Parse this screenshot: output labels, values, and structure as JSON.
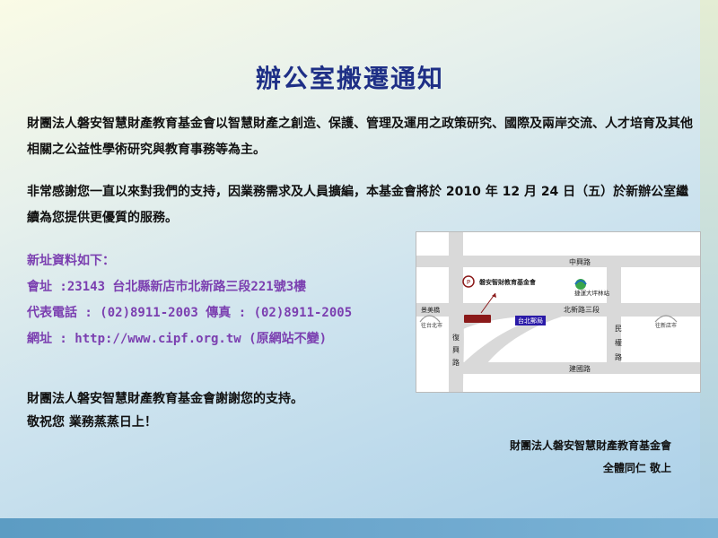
{
  "notice": {
    "title": "辦公室搬遷通知",
    "intro": "財團法人磐安智慧財產教育基金會以智慧財產之創造、保護、管理及運用之政策研究、國際及兩岸交流、人才培育及其他相關之公益性學術研究與教育事務等為主。",
    "relocation": "非常感謝您一直以來對我們的支持，因業務需求及人員擴編，本基金會將於 2010 年 12 月 24 日（五）於新辦公室繼續為您提供更優質的服務。"
  },
  "contact": {
    "heading": "新址資料如下：",
    "address": "會址 :23143 台北縣新店市北新路三段221號3樓",
    "phone": "代表電話 : (02)8911-2003  傳真 : (02)8911-2005",
    "website": "網址 : http://www.cipf.org.tw (原網站不變)"
  },
  "closing": {
    "thanks": "財團法人磐安智慧財產教育基金會謝謝您的支持。",
    "wishes": "敬祝您  業務蒸蒸日上！"
  },
  "signature": {
    "org": "財團法人磐安智慧財產教育基金會",
    "staff": "全體同仁 敬上"
  },
  "map": {
    "road_zhongxing": "中興路",
    "road_beixin": "北新路三段",
    "road_fumei": "復興路",
    "road_minquan": "民權路",
    "road_jianguo": "建國路",
    "bridge": "景美橋",
    "to_taipei": "往台北市",
    "to_xindian": "往新店市",
    "foundation": "磐安智財教育基金會",
    "station": "捷運大坪林站",
    "landmark": "台北郵局",
    "colors": {
      "road": "#d9d9d9",
      "building": "#8b1a1a",
      "landmark_box": "#2a1aa8",
      "station_green": "#3aa64a",
      "station_blue": "#1f6fb8"
    }
  },
  "colors": {
    "title": "#1e2f86",
    "contact_text": "#7b3fb0",
    "body_text": "#111111"
  }
}
